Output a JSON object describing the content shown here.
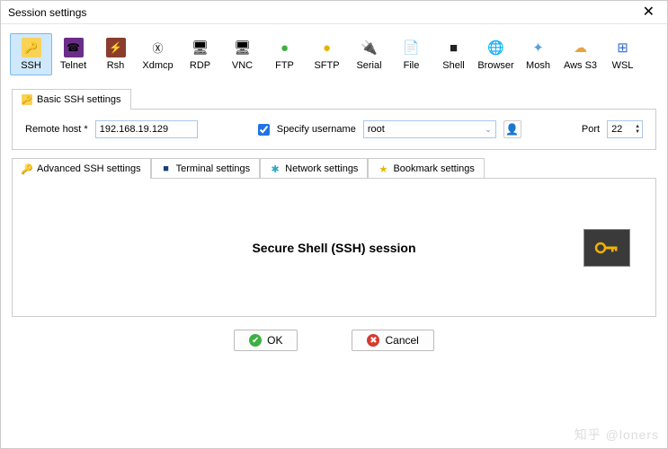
{
  "window": {
    "title": "Session settings"
  },
  "protocols": [
    {
      "label": "SSH",
      "iconName": "key-icon",
      "glyph": "🔑",
      "bg": "#f9d25a",
      "selected": true
    },
    {
      "label": "Telnet",
      "iconName": "telnet-icon",
      "glyph": "☎",
      "bg": "#6b2d8a"
    },
    {
      "label": "Rsh",
      "iconName": "rsh-icon",
      "glyph": "⚡",
      "bg": "#8a3d2d"
    },
    {
      "label": "Xdmcp",
      "iconName": "xdmcp-icon",
      "glyph": "Ⓧ",
      "bg": "#ffffff"
    },
    {
      "label": "RDP",
      "iconName": "rdp-icon",
      "glyph": "🖥",
      "bg": ""
    },
    {
      "label": "VNC",
      "iconName": "vnc-icon",
      "glyph": "🖥",
      "bg": ""
    },
    {
      "label": "FTP",
      "iconName": "ftp-icon",
      "glyph": "●",
      "bg": "",
      "color": "#3db13d"
    },
    {
      "label": "SFTP",
      "iconName": "sftp-icon",
      "glyph": "●",
      "bg": "",
      "color": "#e6b400"
    },
    {
      "label": "Serial",
      "iconName": "serial-icon",
      "glyph": "🔌",
      "bg": ""
    },
    {
      "label": "File",
      "iconName": "file-icon",
      "glyph": "📄",
      "bg": ""
    },
    {
      "label": "Shell",
      "iconName": "shell-icon",
      "glyph": "■",
      "bg": "",
      "color": "#222"
    },
    {
      "label": "Browser",
      "iconName": "browser-icon",
      "glyph": "🌐",
      "bg": ""
    },
    {
      "label": "Mosh",
      "iconName": "mosh-icon",
      "glyph": "✦",
      "bg": "",
      "color": "#5aa0d8"
    },
    {
      "label": "Aws S3",
      "iconName": "aws-icon",
      "glyph": "☁",
      "bg": "",
      "color": "#e6a23c"
    },
    {
      "label": "WSL",
      "iconName": "wsl-icon",
      "glyph": "⊞",
      "bg": "",
      "color": "#2b6cd4"
    }
  ],
  "basicTab": {
    "label": "Basic SSH settings"
  },
  "form": {
    "remoteHostLabel": "Remote host *",
    "remoteHostValue": "192.168.19.129",
    "specifyUsernameLabel": "Specify username",
    "specifyUsernameChecked": true,
    "usernameValue": "root",
    "portLabel": "Port",
    "portValue": "22"
  },
  "subtabs": [
    {
      "label": "Advanced SSH settings",
      "iconName": "key-icon",
      "iconColor": "#c48f00",
      "active": true
    },
    {
      "label": "Terminal settings",
      "iconName": "terminal-icon",
      "iconColor": "#1a3e7a"
    },
    {
      "label": "Network settings",
      "iconName": "network-icon",
      "iconColor": "#2aa7c9"
    },
    {
      "label": "Bookmark settings",
      "iconName": "star-icon",
      "iconColor": "#e6b400"
    }
  ],
  "content": {
    "heading": "Secure Shell (SSH) session"
  },
  "buttons": {
    "ok": "OK",
    "cancel": "Cancel"
  },
  "watermark": "知乎 @loners"
}
